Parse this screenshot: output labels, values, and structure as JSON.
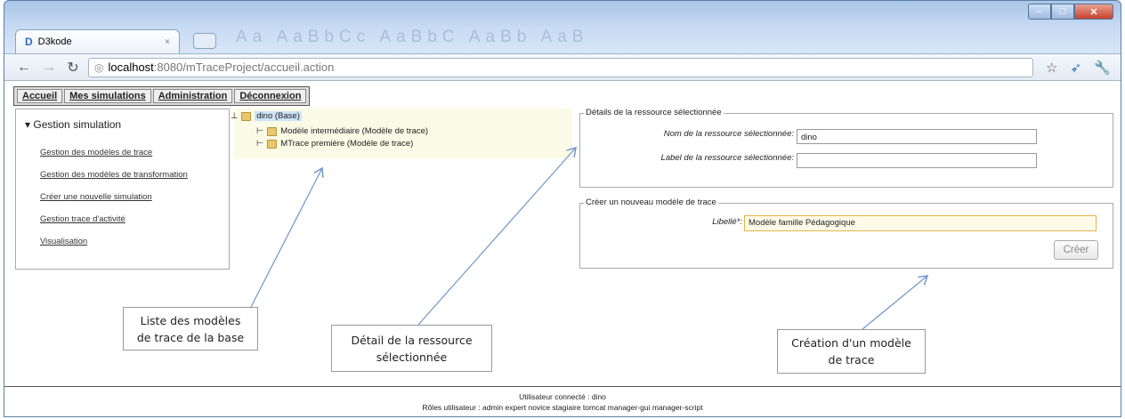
{
  "browser": {
    "tab_title": "D3kode",
    "url_host": "localhost",
    "url_path": ":8080/mTraceProject/accueil.action",
    "ghost_toolbar": "Aa AaBbCc AaBbC AaBb AaB",
    "close_glyph": "×",
    "icons": [
      "back-arrow-icon",
      "forward-arrow-icon",
      "reload-icon",
      "globe-icon",
      "star-icon",
      "extension-icon",
      "wrench-icon"
    ]
  },
  "menu": {
    "items": [
      "Accueil",
      "Mes simulations",
      "Administration",
      "Déconnexion"
    ]
  },
  "sidebar": {
    "header": "Gestion simulation",
    "items": [
      "Gestion des modèles de trace",
      "Gestion des modèles de transformation",
      "Créer une nouvelle simulation",
      "Gestion trace d'activité",
      "Visualisation"
    ]
  },
  "tree": {
    "root": "dino (Base)",
    "children": [
      "Modèle intermédiaire (Modèle de trace)",
      "MTrace première (Modèle de trace)"
    ]
  },
  "details": {
    "legend": "Détails de la ressource sélectionnée",
    "name_label": "Nom de la ressource sélectionnée:",
    "name_value": "dino",
    "label_label": "Label de la ressource sélectionnée:",
    "label_value": ""
  },
  "create": {
    "legend": "Créer un nouveau modèle de trace",
    "libelle_label": "Libellé*:",
    "libelle_value": "Modèle famille Pédagogique",
    "button": "Créer"
  },
  "callouts": {
    "c1": [
      "Liste des modèles",
      "de trace de la base"
    ],
    "c2": [
      "Détail de la ressource",
      "sélectionnée"
    ],
    "c3": [
      "Création d'un modèle",
      "de trace"
    ]
  },
  "footer": {
    "line1": "Utilisateur connecté : dino",
    "line2": "Rôles utilisateur : admin expert novice stagiaire tomcat manager-gui manager-script"
  },
  "colors": {
    "accent": "#2f69c7",
    "focus": "#e5b24a",
    "close": "#c7432f"
  }
}
